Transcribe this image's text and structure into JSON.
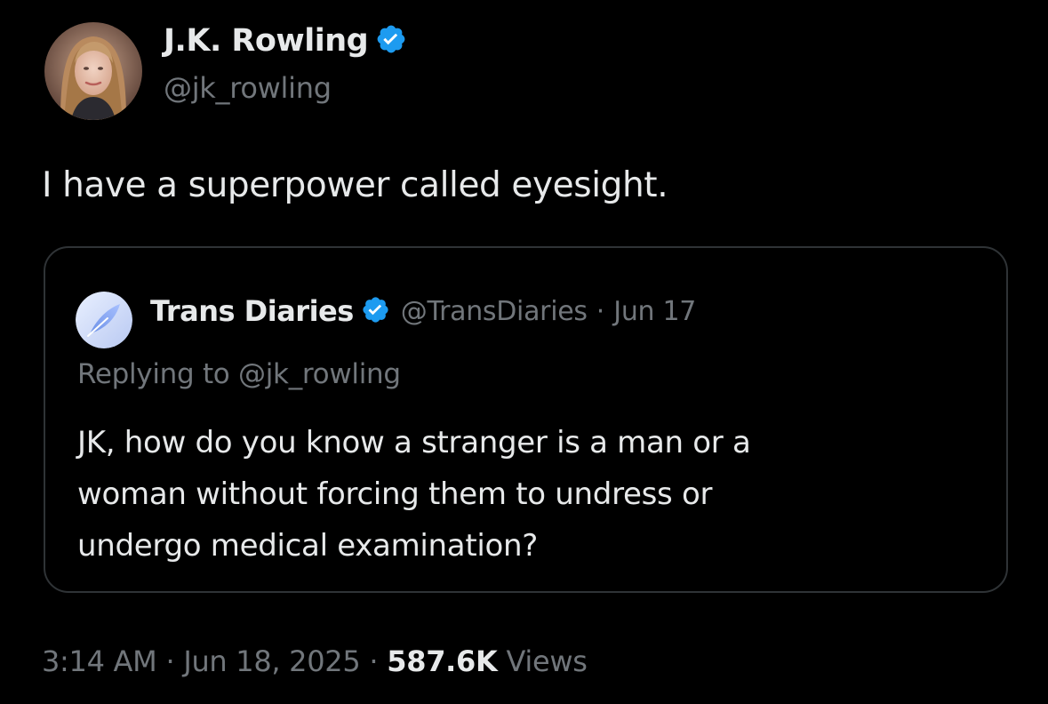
{
  "tweet": {
    "author": {
      "name": "J.K. Rowling",
      "handle": "@jk_rowling",
      "verified": true,
      "avatar": "profile-photo"
    },
    "text": "I have a superpower called eyesight.",
    "quoted": {
      "author": {
        "name": "Trans Diaries",
        "handle": "@TransDiaries",
        "verified": true,
        "avatar": "feather-logo"
      },
      "separator": "·",
      "date": "Jun 17",
      "replying_prefix": "Replying to ",
      "replying_to": "@jk_rowling",
      "text_lines": [
        "JK, how do you know a stranger is a man or a",
        "woman without forcing them to undress or",
        "undergo medical examination?"
      ]
    },
    "meta": {
      "time": "3:14 AM",
      "date": "Jun 18, 2025",
      "separator": "·",
      "views_count": "587.6K",
      "views_label": "Views"
    }
  },
  "colors": {
    "background": "#000000",
    "primary_text": "#e7e9ea",
    "secondary_text": "#71767b",
    "verified_badge": "#1d9bf0",
    "card_border": "#2f3336"
  }
}
